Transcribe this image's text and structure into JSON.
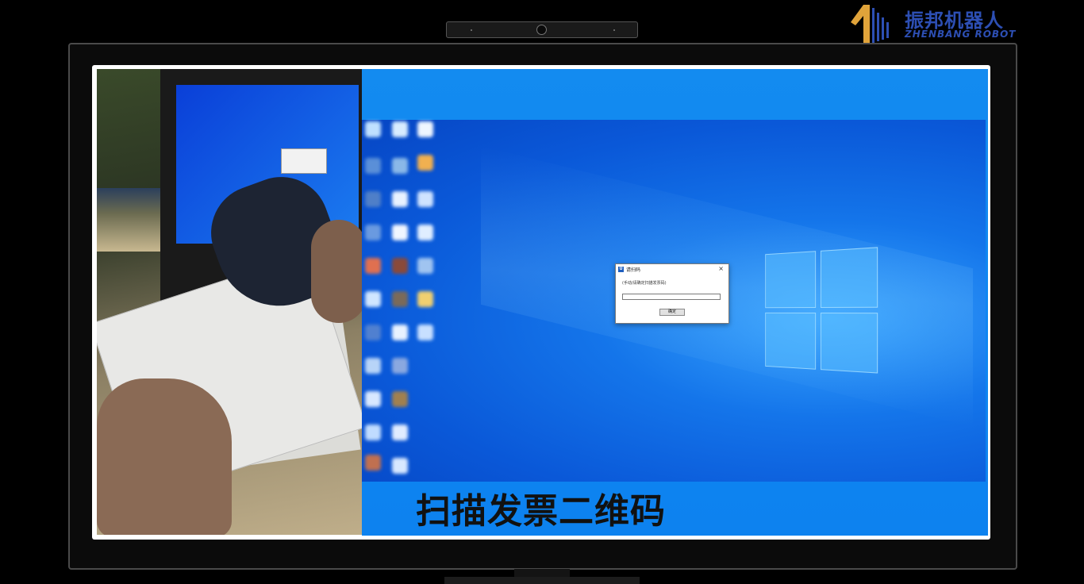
{
  "brand": {
    "name_cn": "振邦机器人",
    "name_en": "ZHENBANG ROBOT",
    "accent_color": "#2d4fb4",
    "logo_accent": "#e0a33a"
  },
  "dialog": {
    "title": "请扫码",
    "prompt": "(手动/请确定扫描发票码)",
    "input_value": "",
    "ok_label": "确定",
    "close_glyph": "×",
    "app_icon_text": "U"
  },
  "caption": {
    "text": "扫描发票二维码"
  },
  "icons": {
    "webcam": "webcam-icon",
    "windows_logo": "windows-logo-icon",
    "close": "close-icon",
    "desktop_icons": "desktop-app-icon"
  },
  "colors": {
    "desktop_blue": "#138bf0",
    "wallpaper_dark": "#0646c4"
  }
}
